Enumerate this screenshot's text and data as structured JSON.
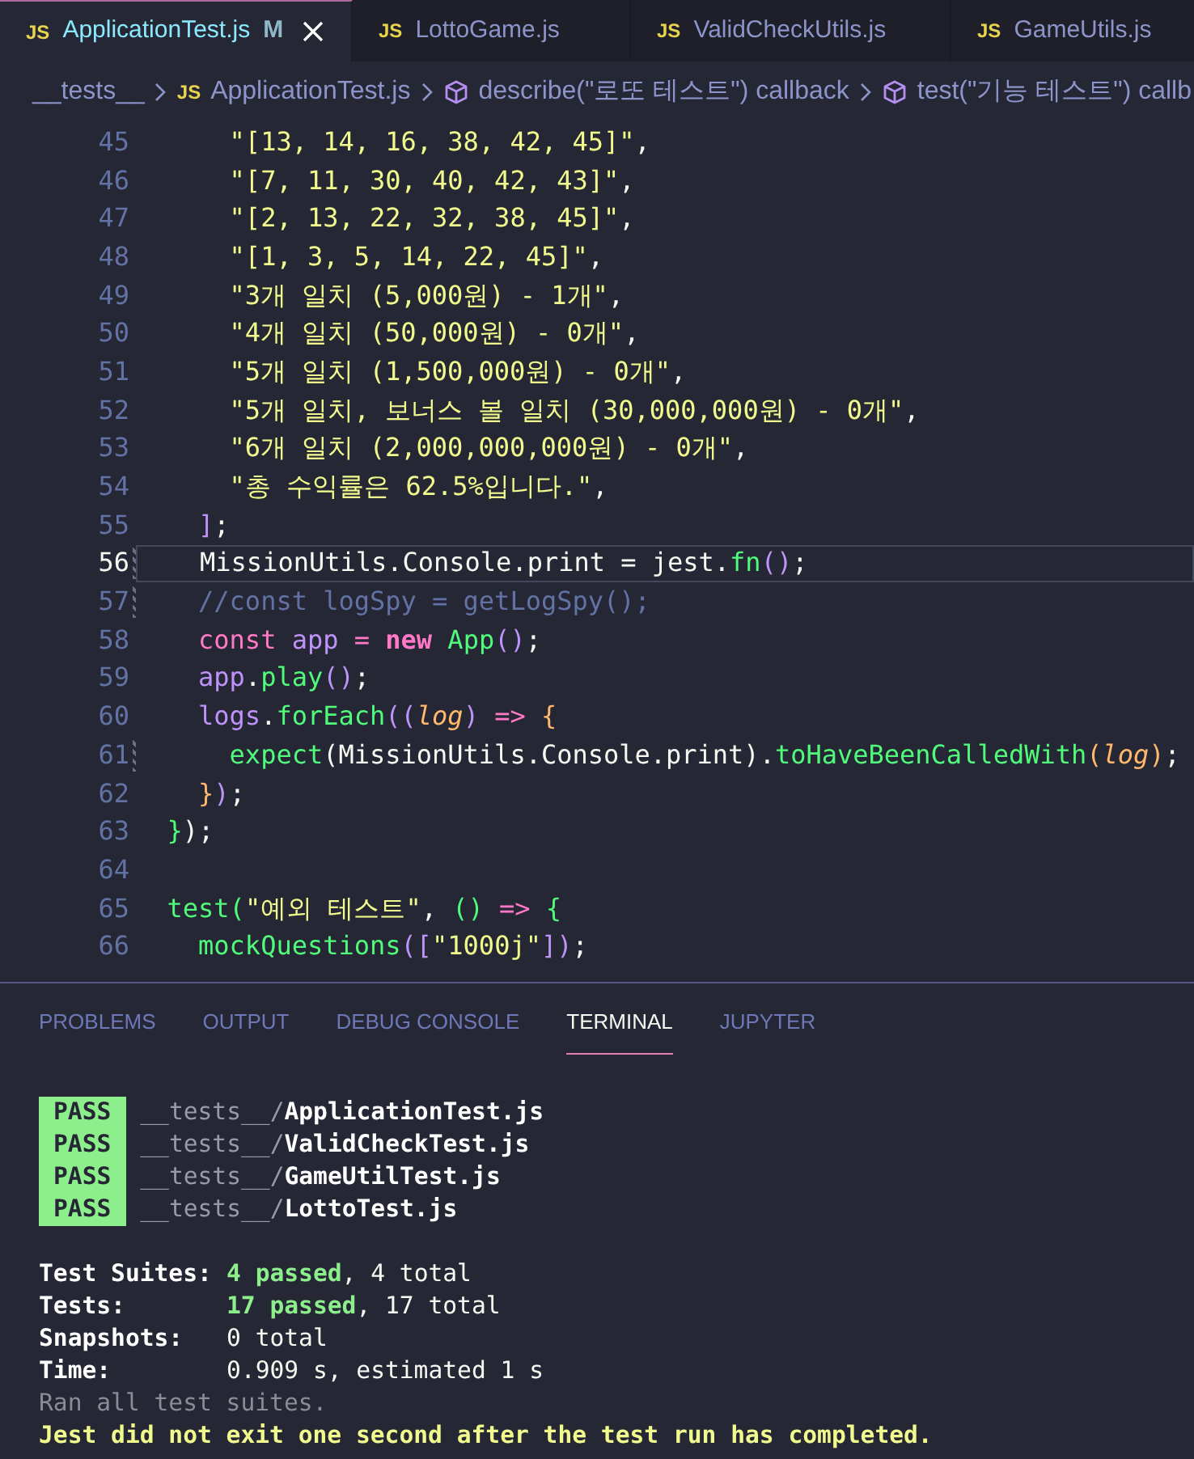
{
  "tabs": [
    {
      "icon": "JS",
      "label": "ApplicationTest.js",
      "status": "M",
      "closable": true,
      "selected": true
    },
    {
      "icon": "JS",
      "label": "LottoGame.js",
      "closable": false,
      "selected": false
    },
    {
      "icon": "JS",
      "label": "ValidCheckUtils.js",
      "closable": false,
      "selected": false
    },
    {
      "icon": "JS",
      "label": "GameUtils.js",
      "closable": false,
      "selected": false
    }
  ],
  "breadcrumb": [
    {
      "kind": "folder",
      "label": "__tests__"
    },
    {
      "kind": "file",
      "icon": "JS",
      "label": "ApplicationTest.js"
    },
    {
      "kind": "symbol",
      "label": "describe(\"로또 테스트\") callback"
    },
    {
      "kind": "symbol",
      "label": "test(\"기능 테스트\") callb"
    }
  ],
  "editor": {
    "lines": [
      {
        "number": "45",
        "current": false,
        "modified": false,
        "tokens": [
          {
            "text": "      \"[13, 14, 16, 38, 42, 45]\"",
            "kind": "string"
          },
          {
            "text": ",",
            "kind": "plain"
          }
        ]
      },
      {
        "number": "46",
        "current": false,
        "modified": false,
        "tokens": [
          {
            "text": "      \"[7, 11, 30, 40, 42, 43]\"",
            "kind": "string"
          },
          {
            "text": ",",
            "kind": "plain"
          }
        ]
      },
      {
        "number": "47",
        "current": false,
        "modified": false,
        "tokens": [
          {
            "text": "      \"[2, 13, 22, 32, 38, 45]\"",
            "kind": "string"
          },
          {
            "text": ",",
            "kind": "plain"
          }
        ]
      },
      {
        "number": "48",
        "current": false,
        "modified": false,
        "tokens": [
          {
            "text": "      \"[1, 3, 5, 14, 22, 45]\"",
            "kind": "string"
          },
          {
            "text": ",",
            "kind": "plain"
          }
        ]
      },
      {
        "number": "49",
        "current": false,
        "modified": false,
        "tokens": [
          {
            "text": "      \"3개 일치 (5,000원) - 1개\"",
            "kind": "string"
          },
          {
            "text": ",",
            "kind": "plain"
          }
        ]
      },
      {
        "number": "50",
        "current": false,
        "modified": false,
        "tokens": [
          {
            "text": "      \"4개 일치 (50,000원) - 0개\"",
            "kind": "string"
          },
          {
            "text": ",",
            "kind": "plain"
          }
        ]
      },
      {
        "number": "51",
        "current": false,
        "modified": false,
        "tokens": [
          {
            "text": "      \"5개 일치 (1,500,000원) - 0개\"",
            "kind": "string"
          },
          {
            "text": ",",
            "kind": "plain"
          }
        ]
      },
      {
        "number": "52",
        "current": false,
        "modified": false,
        "tokens": [
          {
            "text": "      \"5개 일치, 보너스 볼 일치 (30,000,000원) - 0개\"",
            "kind": "string"
          },
          {
            "text": ",",
            "kind": "plain"
          }
        ]
      },
      {
        "number": "53",
        "current": false,
        "modified": false,
        "tokens": [
          {
            "text": "      \"6개 일치 (2,000,000,000원) - 0개\"",
            "kind": "string"
          },
          {
            "text": ",",
            "kind": "plain"
          }
        ]
      },
      {
        "number": "54",
        "current": false,
        "modified": false,
        "tokens": [
          {
            "text": "      \"총 수익률은 62.5%입니다.\"",
            "kind": "string"
          },
          {
            "text": ",",
            "kind": "plain"
          }
        ]
      },
      {
        "number": "55",
        "current": false,
        "modified": false,
        "tokens": [
          {
            "text": "    ]",
            "kind": "b1"
          },
          {
            "text": ";",
            "kind": "plain"
          }
        ]
      },
      {
        "number": "56",
        "current": true,
        "modified": true,
        "tokens": [
          {
            "text": "    MissionUtils.Console.print = jest.",
            "kind": "plain"
          },
          {
            "text": "fn",
            "kind": "func"
          },
          {
            "text": "()",
            "kind": "b1"
          },
          {
            "text": ";",
            "kind": "plain"
          }
        ]
      },
      {
        "number": "57",
        "current": false,
        "modified": true,
        "tokens": [
          {
            "text": "    //const logSpy = getLogSpy();",
            "kind": "comment"
          }
        ]
      },
      {
        "number": "58",
        "current": false,
        "modified": false,
        "tokens": [
          {
            "text": "    const ",
            "kind": "keyword"
          },
          {
            "text": "app",
            "kind": "var"
          },
          {
            "text": " = ",
            "kind": "keyword"
          },
          {
            "text": "new",
            "kind": "new"
          },
          {
            "text": " App",
            "kind": "func"
          },
          {
            "text": "()",
            "kind": "b1"
          },
          {
            "text": ";",
            "kind": "plain"
          }
        ]
      },
      {
        "number": "59",
        "current": false,
        "modified": false,
        "tokens": [
          {
            "text": "    app",
            "kind": "var"
          },
          {
            "text": ".",
            "kind": "plain"
          },
          {
            "text": "play",
            "kind": "func"
          },
          {
            "text": "()",
            "kind": "b1"
          },
          {
            "text": ";",
            "kind": "plain"
          }
        ]
      },
      {
        "number": "60",
        "current": false,
        "modified": false,
        "tokens": [
          {
            "text": "    logs",
            "kind": "var"
          },
          {
            "text": ".",
            "kind": "plain"
          },
          {
            "text": "forEach",
            "kind": "func"
          },
          {
            "text": "((",
            "kind": "b1"
          },
          {
            "text": "log",
            "kind": "param"
          },
          {
            "text": ")",
            "kind": "b1"
          },
          {
            "text": " => ",
            "kind": "keyword"
          },
          {
            "text": "{",
            "kind": "b3"
          }
        ]
      },
      {
        "number": "61",
        "current": false,
        "modified": true,
        "tokens": [
          {
            "text": "      expect",
            "kind": "func"
          },
          {
            "text": "(MissionUtils.Console.print).",
            "kind": "plain"
          },
          {
            "text": "toHaveBeenCalledWith",
            "kind": "func"
          },
          {
            "text": "(",
            "kind": "b3"
          },
          {
            "text": "log",
            "kind": "param"
          },
          {
            "text": ")",
            "kind": "b3"
          },
          {
            "text": ";",
            "kind": "plain"
          }
        ]
      },
      {
        "number": "62",
        "current": false,
        "modified": false,
        "tokens": [
          {
            "text": "    }",
            "kind": "b3"
          },
          {
            "text": ")",
            "kind": "b1"
          },
          {
            "text": ";",
            "kind": "plain"
          }
        ]
      },
      {
        "number": "63",
        "current": false,
        "modified": false,
        "tokens": [
          {
            "text": "  }",
            "kind": "func"
          },
          {
            "text": ");",
            "kind": "plain"
          }
        ]
      },
      {
        "number": "64",
        "current": false,
        "modified": false
      },
      {
        "number": "65",
        "current": false,
        "modified": false,
        "tokens": [
          {
            "text": "  test",
            "kind": "func"
          },
          {
            "text": "(",
            "kind": "b2"
          },
          {
            "text": "\"예외 테스트\"",
            "kind": "string"
          },
          {
            "text": ", ",
            "kind": "plain"
          },
          {
            "text": "()",
            "kind": "b2"
          },
          {
            "text": " => ",
            "kind": "keyword"
          },
          {
            "text": "{",
            "kind": "b2"
          }
        ]
      },
      {
        "number": "66",
        "current": false,
        "modified": false,
        "tokens": [
          {
            "text": "    mockQuestions",
            "kind": "func"
          },
          {
            "text": "([",
            "kind": "b1"
          },
          {
            "text": "\"1000j\"",
            "kind": "string"
          },
          {
            "text": "])",
            "kind": "b1"
          },
          {
            "text": ";",
            "kind": "plain"
          }
        ]
      }
    ]
  },
  "panel": {
    "tabs": [
      {
        "label": "PROBLEMS",
        "selected": false
      },
      {
        "label": "OUTPUT",
        "selected": false
      },
      {
        "label": "DEBUG CONSOLE",
        "selected": false
      },
      {
        "label": "TERMINAL",
        "selected": true
      },
      {
        "label": "JUPYTER",
        "selected": false
      }
    ],
    "terminal": {
      "results": [
        {
          "badge": "PASS",
          "path": "__tests__/",
          "file": "ApplicationTest.js"
        },
        {
          "badge": "PASS",
          "path": "__tests__/",
          "file": "ValidCheckTest.js"
        },
        {
          "badge": "PASS",
          "path": "__tests__/",
          "file": "GameUtilTest.js"
        },
        {
          "badge": "PASS",
          "path": "__tests__/",
          "file": "LottoTest.js"
        }
      ],
      "summary": [
        {
          "label": "Test Suites:",
          "parts": [
            {
              "text": "4 passed",
              "kind": "passed"
            },
            {
              "text": ", 4 total",
              "kind": "plain"
            }
          ]
        },
        {
          "label": "Tests:",
          "parts": [
            {
              "text": "17 passed",
              "kind": "passed"
            },
            {
              "text": ", 17 total",
              "kind": "plain"
            }
          ]
        },
        {
          "label": "Snapshots:",
          "parts": [
            {
              "text": "0 total",
              "kind": "plain"
            }
          ]
        },
        {
          "label": "Time:",
          "parts": [
            {
              "text": "0.909 s, estimated 1 s",
              "kind": "plain"
            }
          ]
        }
      ],
      "messages": [
        {
          "text": "Ran all test suites.",
          "kind": "dim"
        },
        {
          "text": "Jest did not exit one second after the test run has completed.",
          "kind": "warning"
        }
      ]
    }
  }
}
